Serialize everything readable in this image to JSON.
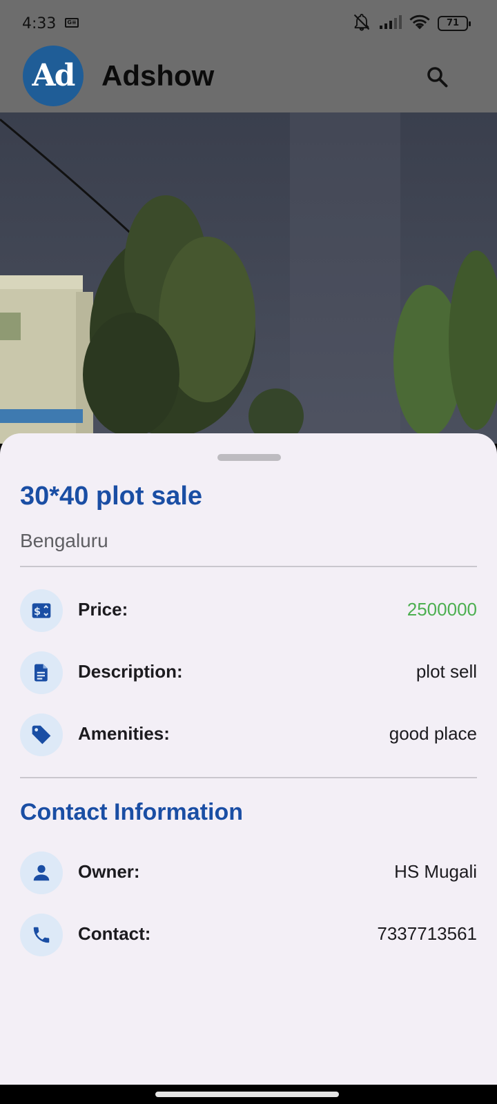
{
  "status_bar": {
    "time": "4:33",
    "sim_label": "G≡",
    "battery": "71",
    "icons": [
      "bell-off-icon",
      "signal-icon",
      "wifi-icon",
      "battery-icon"
    ]
  },
  "app_bar": {
    "logo_text": "Ad",
    "title": "Adshow",
    "search_icon": "search-icon"
  },
  "listing": {
    "title": "30*40 plot sale",
    "location": "Bengaluru",
    "details": [
      {
        "icon": "price-icon",
        "label": "Price:",
        "value": "2500000"
      },
      {
        "icon": "document-icon",
        "label": "Description:",
        "value": "plot sell"
      },
      {
        "icon": "tag-icon",
        "label": "Amenities:",
        "value": "good place"
      }
    ]
  },
  "contact": {
    "section_title": "Contact Information",
    "rows": [
      {
        "icon": "person-icon",
        "label": "Owner:",
        "value": "HS Mugali"
      },
      {
        "icon": "phone-icon",
        "label": "Contact:",
        "value": "7337713561"
      }
    ]
  },
  "colors": {
    "accent": "#1a4ea4",
    "price": "#4caf50",
    "sheet_bg": "#f3eff6",
    "icon_bg": "#dde9f7",
    "header_bg": "#6d6d6d"
  }
}
